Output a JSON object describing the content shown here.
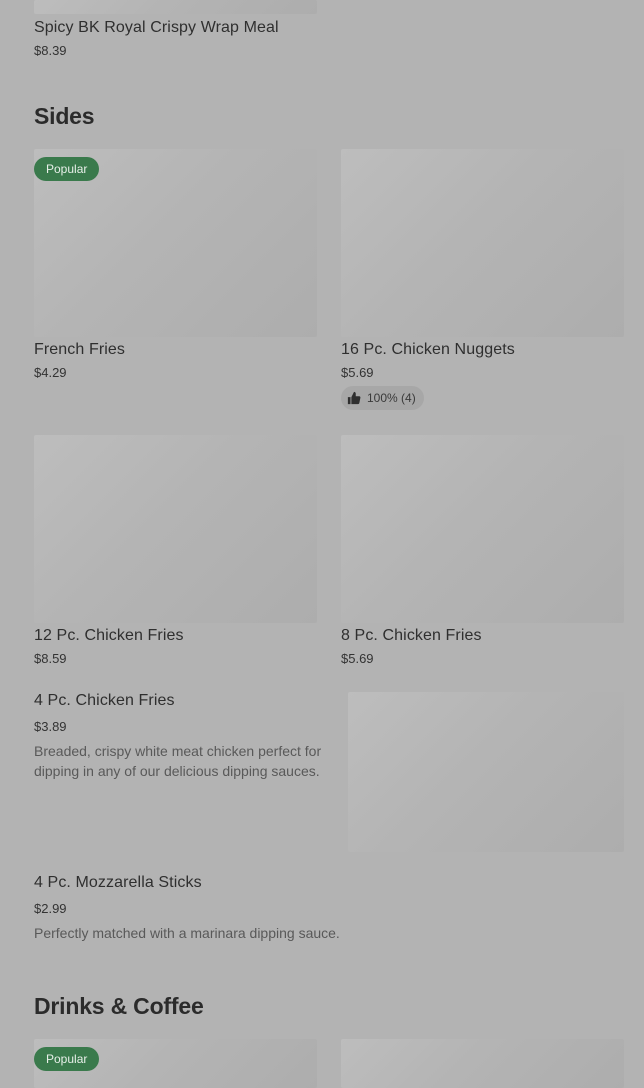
{
  "top_item": {
    "name": "Spicy BK Royal Crispy Wrap  Meal",
    "price": "$8.39"
  },
  "sections": [
    {
      "title": "Sides",
      "grid_items": [
        {
          "name": "French Fries",
          "price": "$4.29",
          "badge": "Popular"
        },
        {
          "name": "16 Pc. Chicken Nuggets",
          "price": "$5.69",
          "rating": "100% (4)"
        },
        {
          "name": "12 Pc. Chicken Fries",
          "price": "$8.59"
        },
        {
          "name": "8 Pc. Chicken Fries",
          "price": "$5.69"
        }
      ],
      "list_items": [
        {
          "name": "4 Pc. Chicken Fries",
          "price": "$3.89",
          "description": "Breaded, crispy white meat chicken perfect for dipping in any of our delicious dipping sauces."
        },
        {
          "name": "4 Pc. Mozzarella Sticks",
          "price": "$2.99",
          "description": "Perfectly matched with a marinara dipping sauce."
        }
      ]
    },
    {
      "title": "Drinks & Coffee",
      "grid_items": [
        {
          "badge": "Popular"
        }
      ]
    }
  ],
  "icons": {
    "rating": "thumbs-up-icon"
  },
  "colors": {
    "badge": "#3a7a4c",
    "overlay_background": "#b3b3b3"
  }
}
